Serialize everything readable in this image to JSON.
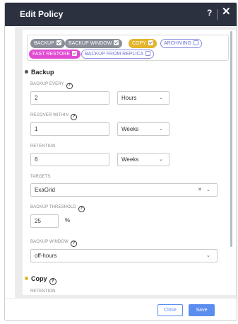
{
  "modal": {
    "title": "Edit Policy",
    "help_label": "?",
    "close_label": "✕"
  },
  "chips": [
    {
      "label": "BACKUP",
      "checked": true,
      "color": "#8a8f98"
    },
    {
      "label": "BACKUP WINDOW",
      "checked": true,
      "color": "#8a8f98"
    },
    {
      "label": "COPY",
      "checked": true,
      "color": "#e2b52c"
    },
    {
      "label": "ARCHIVING",
      "checked": false,
      "color": "#8a8fe0"
    },
    {
      "label": "FAST RESTORE",
      "checked": true,
      "color": "#e24ad4"
    },
    {
      "label": "BACKUP FROM REPLICA",
      "checked": false,
      "color": "#8a8fe0"
    }
  ],
  "backup": {
    "title": "Backup",
    "dot_color": "#555555",
    "backup_every": {
      "label": "BACKUP EVERY",
      "value": "2",
      "unit": "Hours"
    },
    "recover_within": {
      "label": "RECOVER WITHIN",
      "value": "1",
      "unit": "Weeks"
    },
    "retention": {
      "label": "RETENTION",
      "value": "6",
      "unit": "Weeks"
    },
    "targets": {
      "label": "TARGETS",
      "value": "ExaGrid"
    },
    "threshold": {
      "label": "BACKUP THRESHOLD",
      "value": "25",
      "unit": "%"
    },
    "window": {
      "label": "BACKUP WINDOW",
      "value": "off-hours"
    }
  },
  "copy": {
    "title": "Copy",
    "dot_color": "#e2b52c",
    "retention_label": "RETENTION"
  },
  "footer": {
    "close_label": "Close",
    "save_label": "Save"
  },
  "icons": {
    "chevron": "⌄",
    "clear": "✕",
    "question": "?"
  }
}
